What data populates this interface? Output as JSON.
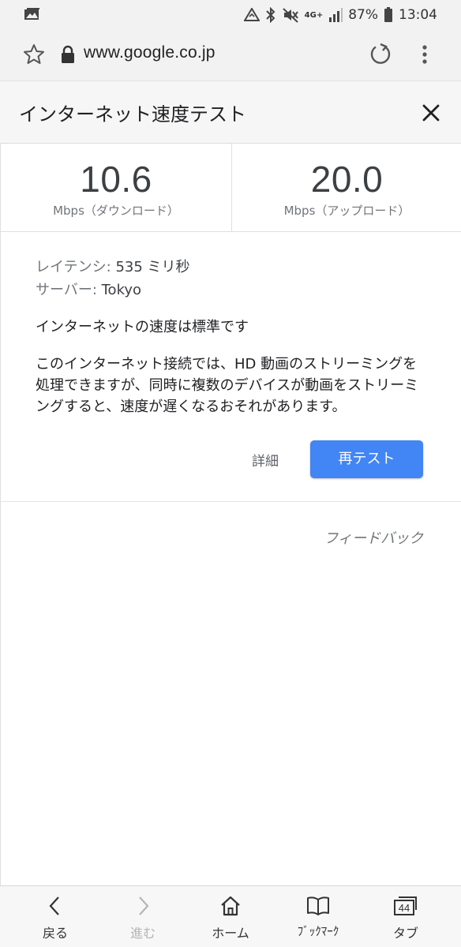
{
  "status_bar": {
    "battery_percent": "87%",
    "time": "13:04",
    "network": "4G+"
  },
  "url_bar": {
    "url": "www.google.co.jp"
  },
  "card": {
    "title": "インターネット速度テスト"
  },
  "results": {
    "download": {
      "value": "10.6",
      "label": "Mbps（ダウンロード）"
    },
    "upload": {
      "value": "20.0",
      "label": "Mbps（アップロード）"
    }
  },
  "details": {
    "latency_label": "レイテンシ:",
    "latency_value": "535 ミリ秒",
    "server_label": "サーバー:",
    "server_value": "Tokyo",
    "summary": "インターネットの速度は標準です",
    "description": "このインターネット接続では、HD 動画のストリーミングを処理できますが、同時に複数のデバイスが動画をストリーミングすると、速度が遅くなるおそれがあります。",
    "details_link": "詳細",
    "retest_button": "再テスト"
  },
  "feedback": "フィードバック",
  "bottom_nav": {
    "back": "戻る",
    "forward": "進む",
    "home": "ホーム",
    "bookmarks": "ﾌﾞｯｸﾏｰｸ",
    "tabs": "タブ",
    "tab_count": "44"
  },
  "colors": {
    "accent": "#4285f4",
    "chrome_bg": "#f2f2f2"
  }
}
